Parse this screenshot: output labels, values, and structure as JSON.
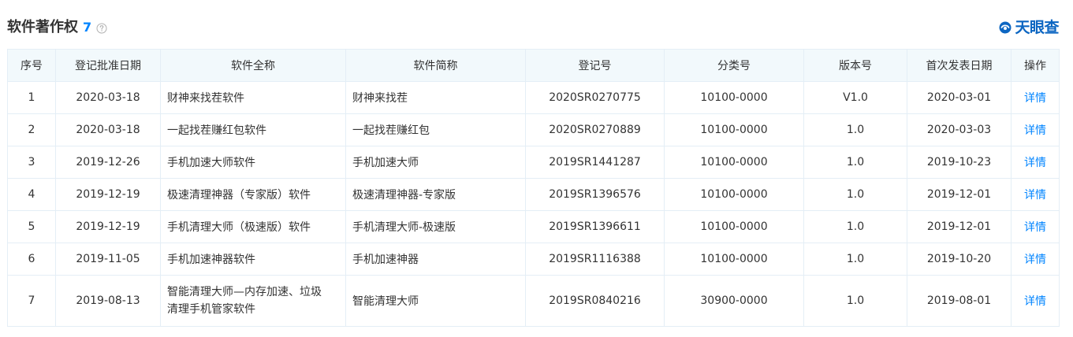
{
  "header": {
    "title": "软件著作权",
    "count": "7",
    "brand": "天眼查"
  },
  "colors": {
    "accent": "#0084ff",
    "header_bg": "#f2f9fc",
    "border": "#e4eef6",
    "brand": "#0c66c2"
  },
  "icons": {
    "help": "question-circle-icon",
    "brand": "tianyancha-logo-icon"
  },
  "table": {
    "columns": [
      "序号",
      "登记批准日期",
      "软件全称",
      "软件简称",
      "登记号",
      "分类号",
      "版本号",
      "首次发表日期",
      "操作"
    ],
    "rows": [
      {
        "no": "1",
        "approval_date": "2020-03-18",
        "full_name": "财神来找茬软件",
        "short_name": "财神来找茬",
        "reg_no": "2020SR0270775",
        "class_no": "10100-0000",
        "version": "V1.0",
        "publish_date": "2020-03-01",
        "action": "详情"
      },
      {
        "no": "2",
        "approval_date": "2020-03-18",
        "full_name": "一起找茬赚红包软件",
        "short_name": "一起找茬赚红包",
        "reg_no": "2020SR0270889",
        "class_no": "10100-0000",
        "version": "1.0",
        "publish_date": "2020-03-03",
        "action": "详情"
      },
      {
        "no": "3",
        "approval_date": "2019-12-26",
        "full_name": "手机加速大师软件",
        "short_name": "手机加速大师",
        "reg_no": "2019SR1441287",
        "class_no": "10100-0000",
        "version": "1.0",
        "publish_date": "2019-10-23",
        "action": "详情"
      },
      {
        "no": "4",
        "approval_date": "2019-12-19",
        "full_name": "极速清理神器（专家版）软件",
        "short_name": "极速清理神器-专家版",
        "reg_no": "2019SR1396576",
        "class_no": "10100-0000",
        "version": "1.0",
        "publish_date": "2019-12-01",
        "action": "详情"
      },
      {
        "no": "5",
        "approval_date": "2019-12-19",
        "full_name": "手机清理大师（极速版）软件",
        "short_name": "手机清理大师-极速版",
        "reg_no": "2019SR1396611",
        "class_no": "10100-0000",
        "version": "1.0",
        "publish_date": "2019-12-01",
        "action": "详情"
      },
      {
        "no": "6",
        "approval_date": "2019-11-05",
        "full_name": "手机加速神器软件",
        "short_name": "手机加速神器",
        "reg_no": "2019SR1116388",
        "class_no": "10100-0000",
        "version": "1.0",
        "publish_date": "2019-10-20",
        "action": "详情"
      },
      {
        "no": "7",
        "approval_date": "2019-08-13",
        "full_name_lines": [
          "智能清理大师—内存加速、垃圾",
          "清理手机管家软件"
        ],
        "short_name": "智能清理大师",
        "reg_no": "2019SR0840216",
        "class_no": "30900-0000",
        "version": "1.0",
        "publish_date": "2019-08-01",
        "action": "详情"
      }
    ]
  }
}
